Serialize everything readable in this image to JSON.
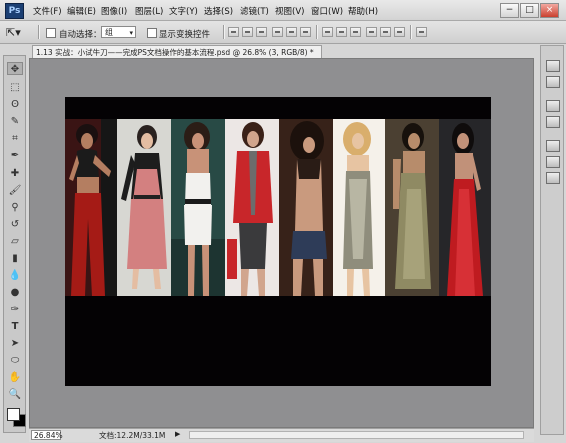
{
  "app": {
    "logo": "Ps"
  },
  "menu": [
    "文件(F)",
    "编辑(E)",
    "图像(I)",
    "图层(L)",
    "文字(Y)",
    "选择(S)",
    "滤镜(T)",
    "视图(V)",
    "窗口(W)",
    "帮助(H)"
  ],
  "window_buttons": {
    "minimize": "−",
    "restore": "□",
    "close": "×"
  },
  "options": {
    "auto_select_label": "自动选择：",
    "auto_select_value": "组",
    "show_transform_label": "显示变换控件"
  },
  "document": {
    "tab_title": "1.13 实战：小试牛刀——完成PS文档操作的基本流程.psd @ 26.8% (3, RGB/8) *",
    "tab_close": "×"
  },
  "status": {
    "zoom": "26.84%",
    "doc_info": "文档:12.2M/33.1M",
    "arrow": "▶"
  },
  "canvas": {
    "background": "#040204"
  },
  "photos": [
    {
      "subject": "woman-red-pants",
      "bg": "#3a1414",
      "skin": "#b47e61",
      "outfit": "#a51b16"
    },
    {
      "subject": "woman-pink-dress",
      "bg": "#d7d7d2",
      "skin": "#e4bda2",
      "outfit": "#d38080"
    },
    {
      "subject": "woman-white-outfit",
      "bg": "#284a45",
      "skin": "#c89278",
      "outfit": "#f2f1ee"
    },
    {
      "subject": "woman-red-jacket",
      "bg": "#ece7e5",
      "skin": "#d1a58d",
      "outfit": "#c8262a"
    },
    {
      "subject": "woman-denim-shorts",
      "bg": "#372219",
      "skin": "#c99a7e",
      "outfit": "#2e3c58"
    },
    {
      "subject": "woman-sequin-dress",
      "bg": "#f5f1ea",
      "skin": "#e7c4a2",
      "outfit": "#8f8d7c"
    },
    {
      "subject": "woman-olive-dress",
      "bg": "#4b4032",
      "skin": "#b78c6b",
      "outfit": "#8f8a63"
    },
    {
      "subject": "woman-red-gown",
      "bg": "#262629",
      "skin": "#c19179",
      "outfit": "#bf1b20"
    }
  ],
  "colors": {
    "foreground": "#ffffff",
    "background": "#000000"
  }
}
